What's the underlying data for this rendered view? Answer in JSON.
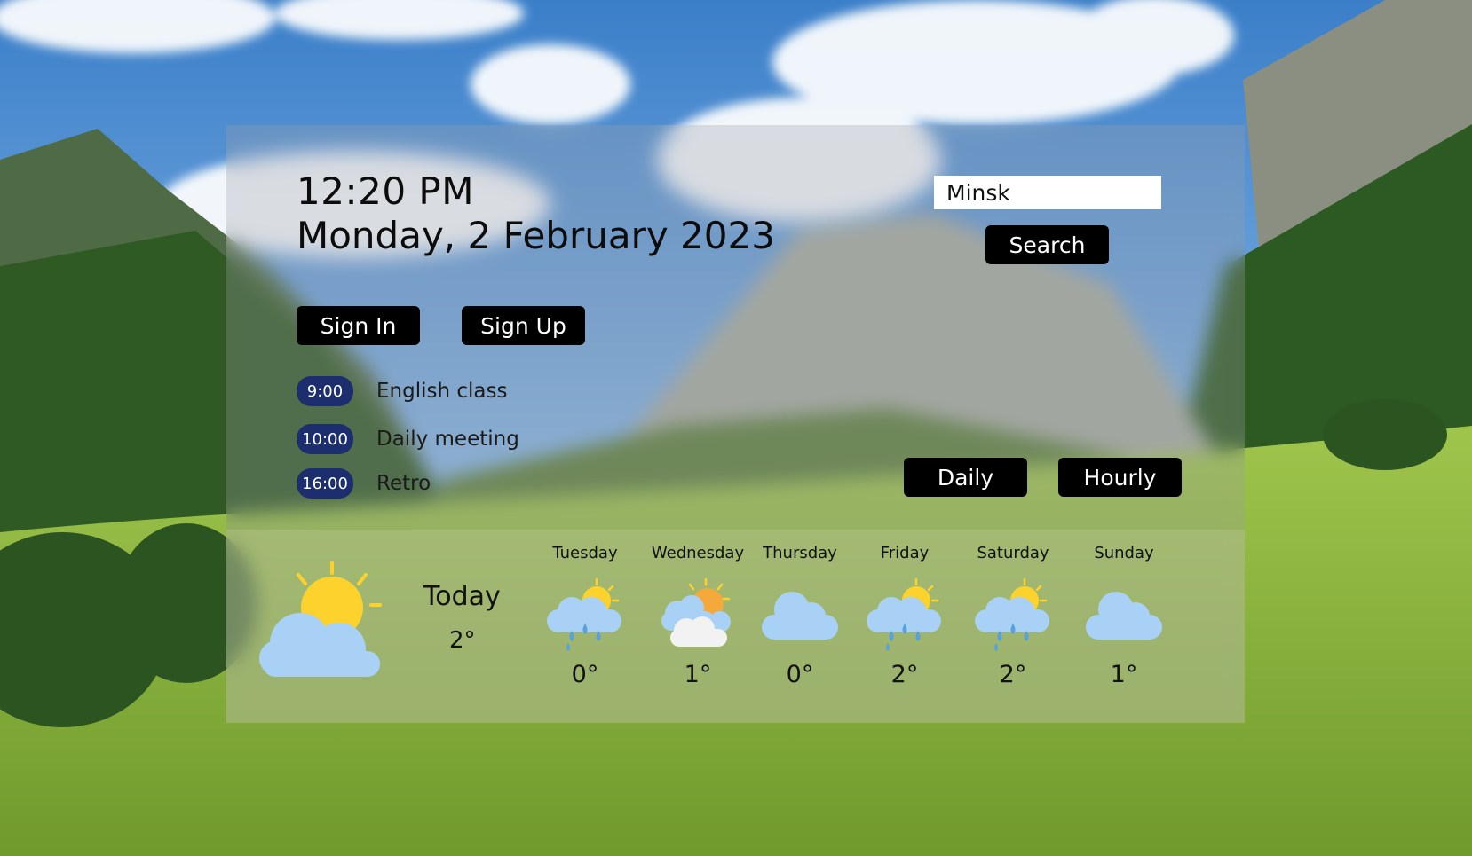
{
  "clock": {
    "time": "12:20 PM",
    "date": "Monday, 2 February 2023"
  },
  "search": {
    "value": "Minsk",
    "button_label": "Search"
  },
  "auth": {
    "sign_in_label": "Sign In",
    "sign_up_label": "Sign Up"
  },
  "events": [
    {
      "time": "9:00",
      "title": "English class"
    },
    {
      "time": "10:00",
      "title": "Daily meeting"
    },
    {
      "time": "16:00",
      "title": "Retro"
    }
  ],
  "view_toggle": {
    "daily_label": "Daily",
    "hourly_label": "Hourly"
  },
  "today": {
    "label": "Today",
    "temp": "2°",
    "icon": "sun-cloud-icon"
  },
  "forecast": [
    {
      "day": "Tuesday",
      "temp": "0°",
      "icon": "sun-rain-cloud-icon"
    },
    {
      "day": "Wednesday",
      "temp": "1°",
      "icon": "sun-clouds-icon"
    },
    {
      "day": "Thursday",
      "temp": "0°",
      "icon": "cloud-icon"
    },
    {
      "day": "Friday",
      "temp": "2°",
      "icon": "sun-rain-cloud-icon"
    },
    {
      "day": "Saturday",
      "temp": "2°",
      "icon": "sun-rain-cloud-icon"
    },
    {
      "day": "Sunday",
      "temp": "1°",
      "icon": "cloud-icon"
    }
  ],
  "colors": {
    "event_badge": "#1d2e6e",
    "button": "#000000",
    "sun": "#fdd22c",
    "cloud": "#a8d1f5"
  }
}
